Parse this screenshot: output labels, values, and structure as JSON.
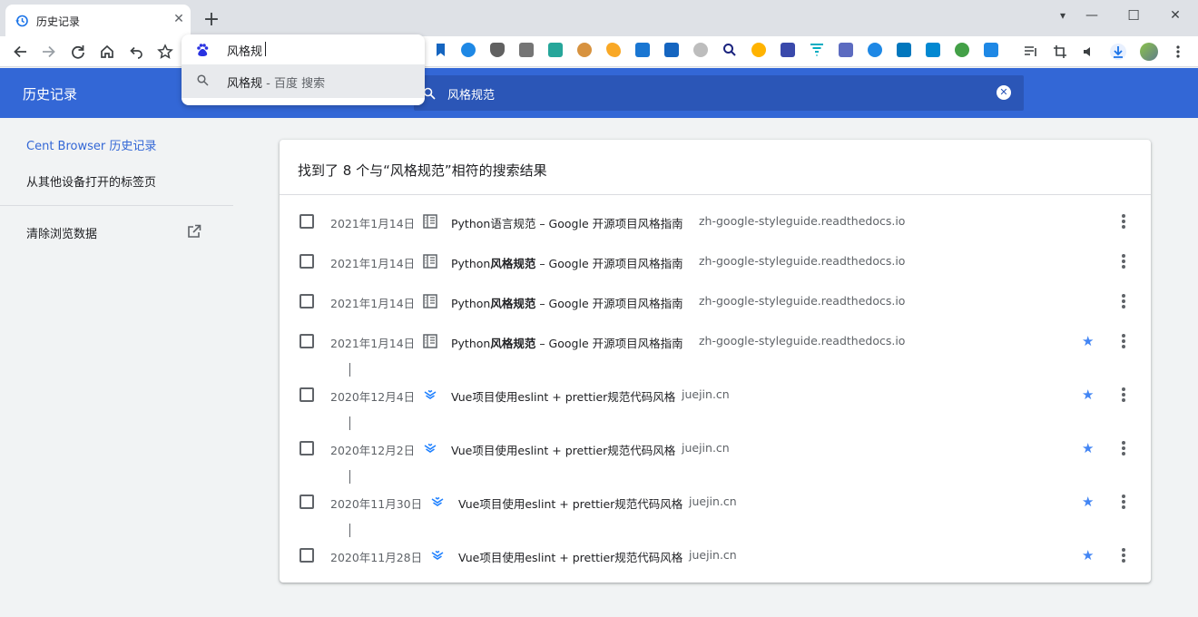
{
  "tab": {
    "title": "历史记录",
    "close": "✕"
  },
  "new_tab": "+",
  "window": {
    "minimize": "—",
    "maximize": "☐",
    "close": "✕",
    "tabs_menu": "▾"
  },
  "omnibox": {
    "input": "风格规",
    "suggestion": {
      "query": "风格规",
      "separator": " - ",
      "engine": "百度 搜索"
    }
  },
  "header": {
    "title": "历史记录",
    "search": "风格规范",
    "clear": "✕"
  },
  "sidebar": {
    "items": [
      {
        "label": "Cent Browser 历史记录",
        "active": true
      },
      {
        "label": "从其他设备打开的标签页",
        "active": false
      },
      {
        "label": "清除浏览数据",
        "active": false
      }
    ]
  },
  "results": {
    "summary": "找到了 8 个与“风格规范”相符的搜索结果",
    "rows": [
      {
        "date": "2021年1月14日",
        "title_pre": "Python",
        "title_bold": "语言规范",
        "title_post": " – Google 开源项目风格指南",
        "domain": "zh-google-styleguide.readthedocs.io",
        "starred": false,
        "bold_is_match": false
      },
      {
        "date": "2021年1月14日",
        "title_pre": "Python",
        "title_bold": "风格规范",
        "title_post": " – Google 开源项目风格指南",
        "domain": "zh-google-styleguide.readthedocs.io",
        "starred": false,
        "bold_is_match": true
      },
      {
        "date": "2021年1月14日",
        "title_pre": "Python",
        "title_bold": "风格规范",
        "title_post": " – Google 开源项目风格指南",
        "domain": "zh-google-styleguide.readthedocs.io",
        "starred": false,
        "bold_is_match": true
      },
      {
        "date": "2021年1月14日",
        "title_pre": "Python",
        "title_bold": "风格规范",
        "title_post": " – Google 开源项目风格指南",
        "domain": "zh-google-styleguide.readthedocs.io",
        "starred": true,
        "bold_is_match": true
      },
      {
        "date": "2020年12月4日",
        "title_pre": "Vue项目使用eslint + prettier规范代码风格",
        "title_bold": "",
        "title_post": "",
        "domain": "juejin.cn",
        "starred": true,
        "bold_is_match": false
      },
      {
        "date": "2020年12月2日",
        "title_pre": "Vue项目使用eslint + prettier规范代码风格",
        "title_bold": "",
        "title_post": "",
        "domain": "juejin.cn",
        "starred": true,
        "bold_is_match": false
      },
      {
        "date": "2020年11月30日",
        "title_pre": "Vue项目使用eslint + prettier规范代码风格",
        "title_bold": "",
        "title_post": "",
        "domain": "juejin.cn",
        "starred": true,
        "bold_is_match": false
      },
      {
        "date": "2020年11月28日",
        "title_pre": "Vue项目使用eslint + prettier规范代码风格",
        "title_bold": "",
        "title_post": "",
        "domain": "juejin.cn",
        "starred": true,
        "bold_is_match": false
      }
    ]
  },
  "colors": {
    "header_bg": "#3367d6",
    "search_bg": "#2b56b7",
    "accent": "#3367d6",
    "star": "#4285f4"
  },
  "icons": {
    "toolbar": [
      "back-icon",
      "forward-icon",
      "reload-icon",
      "home-icon",
      "undo-close-tab-icon",
      "bookmark-star-icon"
    ],
    "favicons": {
      "python": "readthedocs-book-icon",
      "vue": "juejin-icon"
    }
  }
}
